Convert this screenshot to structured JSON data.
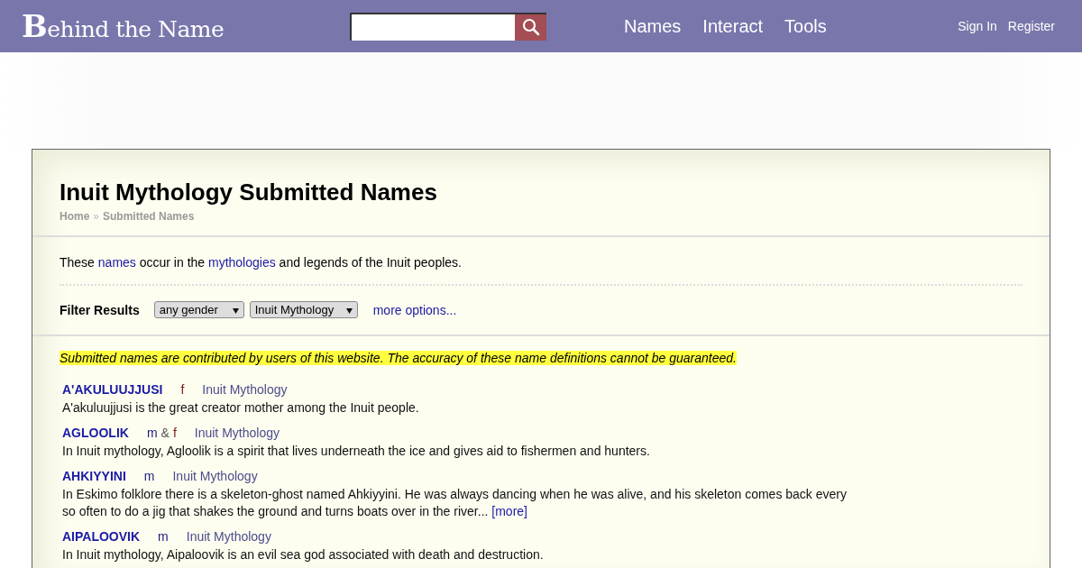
{
  "header": {
    "logo": "Behind the Name",
    "nav": [
      "Names",
      "Interact",
      "Tools"
    ],
    "account": [
      "Sign In",
      "Register"
    ]
  },
  "page": {
    "title": "Inuit Mythology Submitted Names",
    "breadcrumb": [
      "Home",
      "Submitted Names"
    ],
    "breadcrumb_separator": "»",
    "intro": [
      {
        "kind": "text",
        "text": "These "
      },
      {
        "kind": "link",
        "text": "names"
      },
      {
        "kind": "text",
        "text": " occur in the "
      },
      {
        "kind": "link",
        "text": "mythologies"
      },
      {
        "kind": "text",
        "text": " and legends of the Inuit peoples."
      }
    ],
    "filter": {
      "label": "Filter Results",
      "selects": [
        "any gender",
        "Inuit Mythology"
      ],
      "more": "more options..."
    },
    "notice": "Submitted names are contributed by users of this website. The accuracy of these name definitions cannot be guaranteed.",
    "names": [
      {
        "name": "A'AKULUUJJUSI",
        "gender": [
          {
            "kind": "feminine",
            "text": "f"
          }
        ],
        "usage": "Inuit Mythology",
        "description": "A'akuluujjusi is the great creator mother among the Inuit people."
      },
      {
        "name": "AGLOOLIK",
        "gender": [
          {
            "kind": "masculine",
            "text": "m"
          },
          {
            "kind": "separator",
            "text": "&"
          },
          {
            "kind": "feminine",
            "text": "f"
          }
        ],
        "usage": "Inuit Mythology",
        "description": "In Inuit mythology, Agloolik is a spirit that lives underneath the ice and gives aid to fishermen and hunters."
      },
      {
        "name": "AHKIYYINI",
        "gender": [
          {
            "kind": "masculine",
            "text": "m"
          }
        ],
        "usage": "Inuit Mythology",
        "description": "In Eskimo folklore there is a skeleton-ghost named Ahkiyyini. He was always dancing when he was alive, and his skeleton comes back every so often to do a jig that shakes the ground and turns boats over in the river...",
        "more": "[more]"
      },
      {
        "name": "AIPALOOVIK",
        "gender": [
          {
            "kind": "masculine",
            "text": "m"
          }
        ],
        "usage": "Inuit Mythology",
        "description": "In Inuit mythology, Aipaloovik is an evil sea god associated with death and destruction."
      }
    ]
  }
}
